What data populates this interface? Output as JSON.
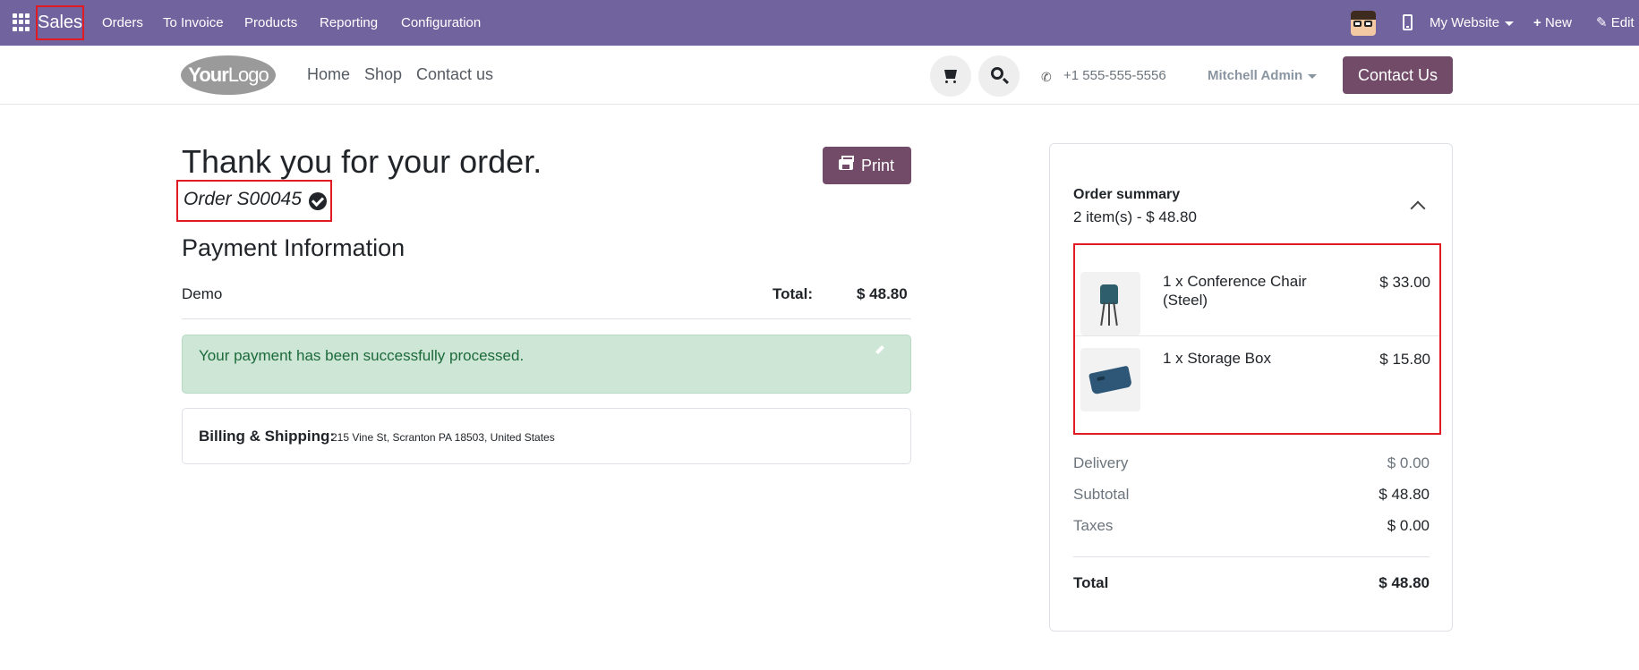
{
  "topbar": {
    "app_name": "Sales",
    "menu": [
      "Orders",
      "To Invoice",
      "Products",
      "Reporting",
      "Configuration"
    ],
    "website": "My Website",
    "new_label": "New",
    "edit_label": "Edit",
    "color": "#71639e"
  },
  "header": {
    "logo_bold": "Your",
    "logo_thin": "Logo",
    "nav": [
      "Home",
      "Shop",
      "Contact us"
    ],
    "phone": "+1 555-555-5556",
    "user": "Mitchell Admin",
    "contact_button": "Contact Us",
    "accent": "#714b67"
  },
  "main": {
    "title": "Thank you for your order.",
    "print_label": "Print",
    "order_label": "Order S00045",
    "payment_title": "Payment Information",
    "payment_method": "Demo",
    "total_label": "Total:",
    "total_value": "$ 48.80",
    "alert_text": "Your payment has been successfully processed.",
    "billing_label": "Billing & Shipping:",
    "billing_address": "215 Vine St, Scranton PA 18503, United States"
  },
  "summary": {
    "title": "Order summary",
    "subtitle": "2 item(s) -  $ 48.80",
    "items": [
      {
        "name": "1 x Conference Chair (Steel)",
        "price": "$ 33.00"
      },
      {
        "name": "1 x Storage Box",
        "price": "$ 15.80"
      }
    ],
    "delivery_label": "Delivery",
    "delivery_value": "$ 0.00",
    "subtotal_label": "Subtotal",
    "subtotal_value": "$ 48.80",
    "taxes_label": "Taxes",
    "taxes_value": "$ 0.00",
    "total_label": "Total",
    "total_value": "$ 48.80"
  }
}
